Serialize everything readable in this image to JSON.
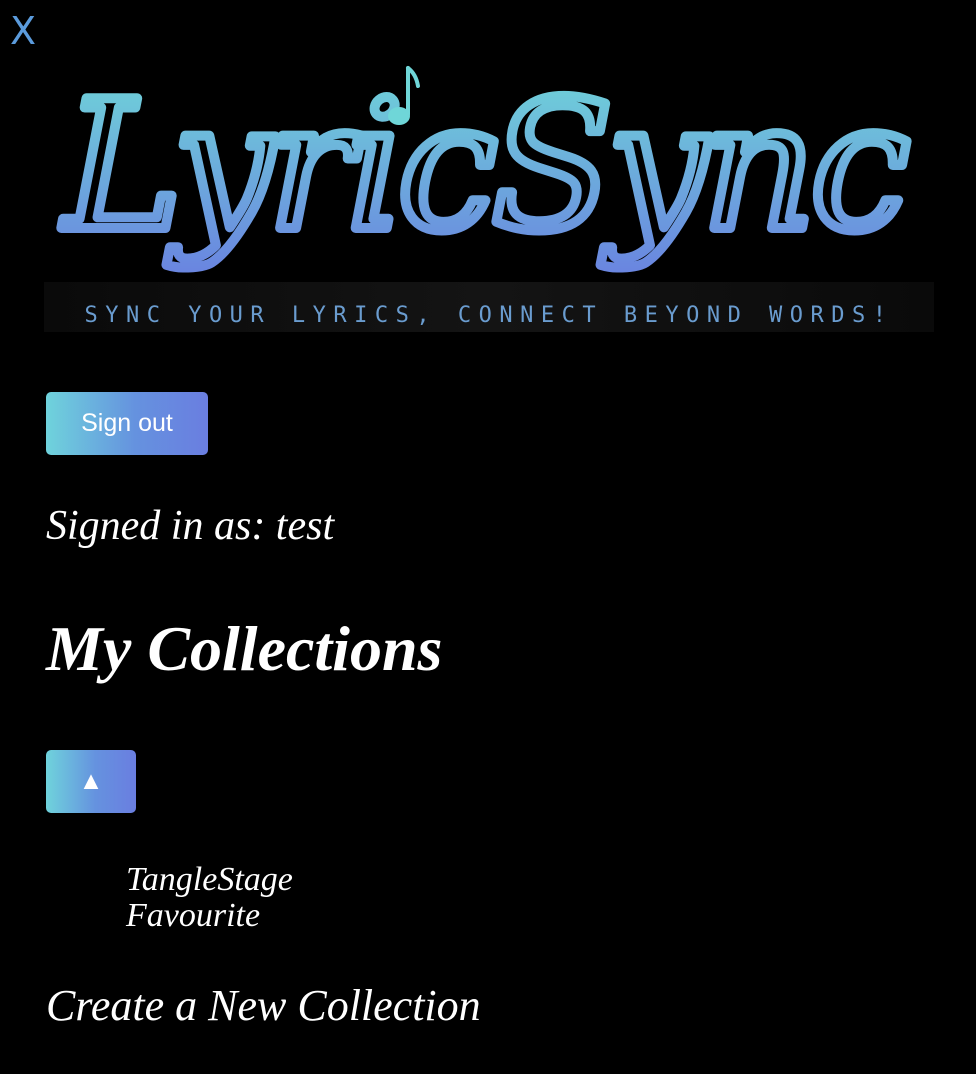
{
  "close": {
    "label": "X",
    "icon": "close-icon"
  },
  "logo": {
    "wordmark": "LyricSync",
    "tagline": "SYNC YOUR LYRICS, CONNECT BEYOND WORDS!",
    "note_icon": "music-note-icon",
    "gradient": [
      "#6fd6d8",
      "#6a86e0"
    ],
    "tagline_color": "#6a9ccf"
  },
  "auth": {
    "signout_label": "Sign out",
    "signed_in_text": "Signed in as: test"
  },
  "collections": {
    "title": "My Collections",
    "toggle_icon": "▲",
    "items": [
      {
        "name": "TangleStage"
      },
      {
        "name": "Favourite"
      }
    ],
    "create_label": "Create a New Collection"
  },
  "colors": {
    "background": "#000000",
    "text": "#ffffff",
    "accent": "#5b9bdc",
    "button_gradient_start": "#6fd3dc",
    "button_gradient_end": "#6a7ee0"
  }
}
